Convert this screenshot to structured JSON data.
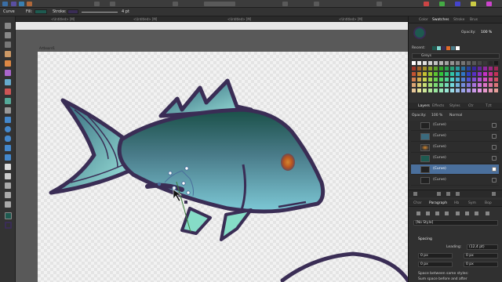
{
  "context_toolbar": {
    "tool_name": "Curve",
    "fill_label": "Fill:",
    "stroke_label": "Stroke:",
    "stroke_width": "4 pt"
  },
  "doc_tabs": [
    "<Untitled> [M]",
    "<Untitled> [M]",
    "<Untitled> [M]",
    "<Untitled> [M]"
  ],
  "artboard_label": "Artboard1",
  "panel": {
    "top_tabs": [
      "Color",
      "Swatches",
      "Stroke",
      "Brus"
    ],
    "opacity_label": "Opacity:",
    "opacity_value": "100 %",
    "recent_label": "Recent:",
    "palette_name": "Greys",
    "layer_tabs": [
      "Layers",
      "Effects",
      "Styles",
      "Ctr",
      "T,tt"
    ],
    "layer_opacity_label": "Opacity:",
    "layer_opacity_value": "100 %",
    "blend_mode": "Normal",
    "layers": [
      "(Curve)",
      "(Curve)",
      "(Curve)",
      "(Curve)",
      "(Curve)",
      "(Curve)"
    ],
    "selected_layer_index": 4,
    "text_tabs": [
      "Char",
      "Paragraph",
      "Hb",
      "Sym",
      "Bop"
    ],
    "paragraph_style": "[No Style]",
    "spacing_label": "Spacing",
    "leading_label": "Leading:",
    "leading_value": "(12,4 pt)",
    "spacing_fields": [
      "0 px",
      "0 px",
      "0 px",
      "0 px"
    ],
    "space_between_label": "Space between same styles:",
    "sum_space_label": "Sum space before and after"
  },
  "colors": {
    "fish_body_dark": "#1e5a50",
    "fish_body_light": "#7fd8cf",
    "outline": "#3a2d55",
    "eye": "#e06a2a",
    "selection_blue": "#4a6f9c"
  }
}
